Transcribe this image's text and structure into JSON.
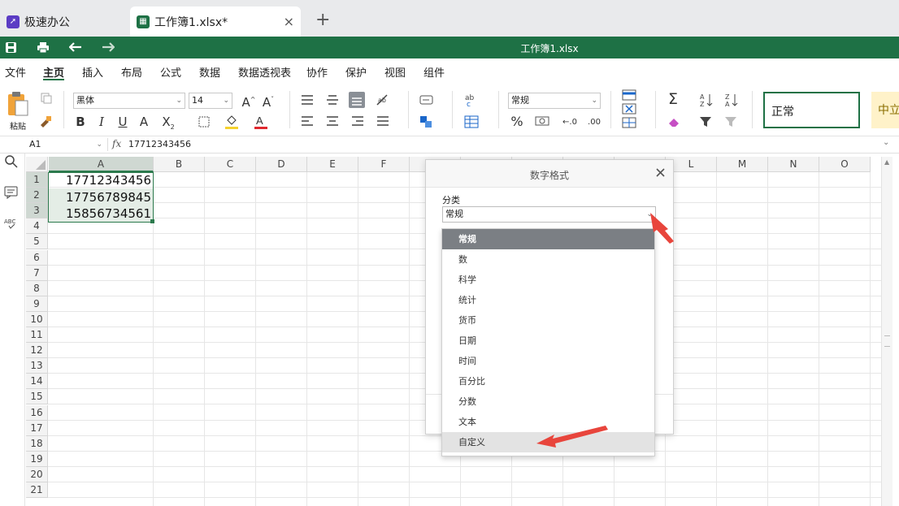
{
  "tabs": [
    {
      "label": "极速办公"
    },
    {
      "label": "工作簿1.xlsx*",
      "close": "×"
    }
  ],
  "new_tab": "+",
  "title": "工作簿1.xlsx",
  "menu": [
    "文件",
    "主页",
    "插入",
    "布局",
    "公式",
    "数据",
    "数据透视表",
    "协作",
    "保护",
    "视图",
    "组件"
  ],
  "active_menu": "主页",
  "ribbon": {
    "paste_label": "粘贴",
    "font_name": "黑体",
    "font_size": "14",
    "number_format": "常规",
    "style_normal": "正常",
    "style_neutral": "中立"
  },
  "formula_bar": {
    "cell_ref": "A1",
    "fx": "fx",
    "value": "17712343456"
  },
  "columns": [
    "A",
    "B",
    "C",
    "D",
    "E",
    "F",
    "G",
    "H",
    "I",
    "J",
    "K",
    "L",
    "M",
    "N",
    "O"
  ],
  "rows": [
    "1",
    "2",
    "3",
    "4",
    "5",
    "6",
    "7",
    "8",
    "9",
    "10",
    "11",
    "12",
    "13",
    "14",
    "15",
    "16",
    "17",
    "18",
    "19",
    "20",
    "21"
  ],
  "cells": [
    {
      "ref": "A1",
      "value": "17712343456"
    },
    {
      "ref": "A2",
      "value": "17756789845"
    },
    {
      "ref": "A3",
      "value": "15856734561"
    }
  ],
  "dialog": {
    "title": "数字格式",
    "category_label": "分类",
    "category_value": "常规",
    "options": [
      "常规",
      "数",
      "科学",
      "统计",
      "货币",
      "日期",
      "时间",
      "百分比",
      "分数",
      "文本",
      "自定义"
    ],
    "selected": "常规",
    "hovered": "自定义"
  },
  "colors": {
    "titlebar": "#1e7145",
    "selected_option": "#7b7f84",
    "arrow": "#e8453c"
  }
}
